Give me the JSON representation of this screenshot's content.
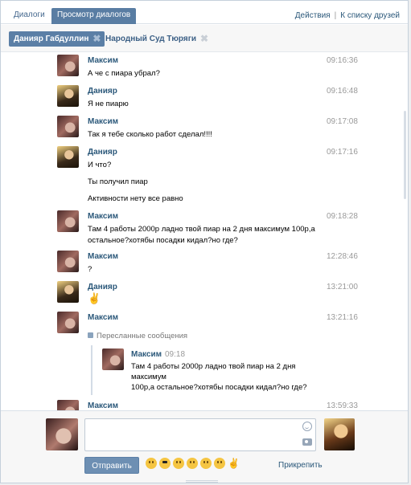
{
  "tabs": {
    "dialogs": "Диалоги",
    "view": "Просмотр диалогов"
  },
  "top_links": {
    "actions": "Действия",
    "sep": "|",
    "friends": "К списку друзей"
  },
  "chats": [
    {
      "name": "Данияр Габдуллин",
      "close": "✖"
    },
    {
      "name": "Народный Суд Тюряги",
      "close": "✖"
    }
  ],
  "messages": [
    {
      "author": "Максим",
      "time": "09:16:36",
      "lines": [
        "А че с пиара убрал?"
      ],
      "avatar": "maxim"
    },
    {
      "author": "Данияр",
      "time": "09:16:48",
      "lines": [
        "Я не пиарю"
      ],
      "avatar": "daniyar"
    },
    {
      "author": "Максим",
      "time": "09:17:08",
      "lines": [
        "Так я тебе сколько работ сделал!!!!"
      ],
      "avatar": "maxim"
    },
    {
      "author": "Данияр",
      "time": "09:17:16",
      "lines": [
        "И что?",
        "Ты получил пиар",
        "Активности нету все равно"
      ],
      "avatar": "daniyar"
    },
    {
      "author": "Максим",
      "time": "09:18:28",
      "lines": [
        "Там 4 работы 2000р ладно твой пиар на 2 дня максимум 100р,а",
        "остальное?хотябы посадки кидал?но где?"
      ],
      "avatar": "maxim"
    },
    {
      "author": "Максим",
      "time": "12:28:46",
      "lines": [
        "?"
      ],
      "avatar": "maxim"
    },
    {
      "author": "Данияр",
      "time": "13:21:00",
      "lines": [
        "✌"
      ],
      "avatar": "daniyar"
    },
    {
      "author": "Максим",
      "time": "13:21:16",
      "lines": [],
      "avatar": "maxim"
    },
    {
      "author": "Максим",
      "time": "13:59:33",
      "lines": [],
      "avatar": "maxim"
    }
  ],
  "forwarded": {
    "header": "Пересланные сообщения",
    "author": "Максим",
    "time": "09:18",
    "line1": "Там 4 работы 2000р ладно твой пиар на 2 дня максимум",
    "line2": "100р,а остальное?хотябы посадки кидал?но где?"
  },
  "composer": {
    "send": "Отправить",
    "attach": "Прикрепить",
    "emojis": [
      "laughing",
      "sunglasses",
      "blowing-kiss",
      "grin",
      "smile",
      "crying-laughing",
      "victory-hand"
    ]
  }
}
